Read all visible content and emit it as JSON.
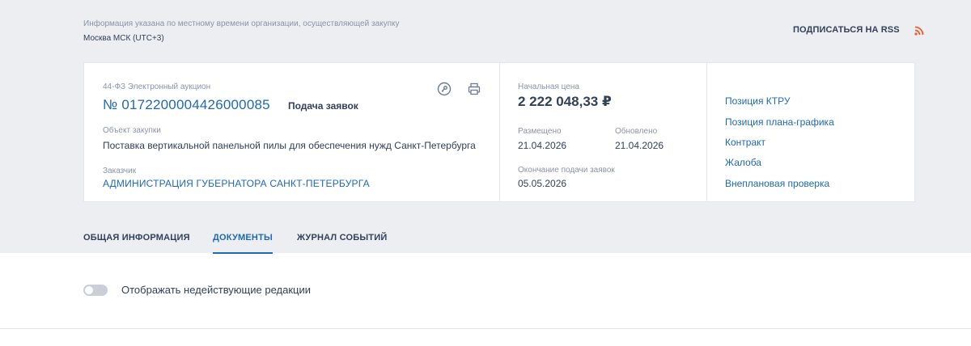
{
  "header": {
    "timezone_note": "Информация указана по местному времени организации, осуществляющей закупку",
    "timezone_value": "Москва МСК (UTC+3)",
    "rss_label": "ПОДПИСАТЬСЯ НА RSS",
    "rss_icon": "rss-icon",
    "rss_color": "#f0592a"
  },
  "procurement": {
    "type": "44-ФЗ Электронный аукцион",
    "number": "№ 0172200004426000085",
    "stage": "Подача заявок",
    "object_label": "Объект закупки",
    "object_value": "Поставка вертикальной панельной пилы для обеспечения нужд Санкт-Петербурга",
    "customer_label": "Заказчик",
    "customer_value": "АДМИНИСТРАЦИЯ ГУБЕРНАТОРА САНКТ-ПЕТЕРБУРГА",
    "icons": [
      "key-icon",
      "print-icon"
    ]
  },
  "pricing": {
    "price_label": "Начальная цена",
    "price_value": "2 222 048,33 ₽",
    "placed_label": "Размещено",
    "placed_value": "21.04.2026",
    "updated_label": "Обновлено",
    "updated_value": "21.04.2026",
    "end_label": "Окончание подачи заявок",
    "end_value": "05.05.2026"
  },
  "side_links": [
    "Позиция КТРУ",
    "Позиция плана-графика",
    "Контракт",
    "Жалоба",
    "Внеплановая проверка"
  ],
  "tabs": [
    {
      "label": "ОБЩАЯ ИНФОРМАЦИЯ",
      "active": false
    },
    {
      "label": "ДОКУМЕНТЫ",
      "active": true
    },
    {
      "label": "ЖУРНАЛ СОБЫТИЙ",
      "active": false
    }
  ],
  "toggle": {
    "label": "Отображать недействующие редакции",
    "on": false
  },
  "colors": {
    "accent": "#1f69b2",
    "background": "#eceef1"
  }
}
